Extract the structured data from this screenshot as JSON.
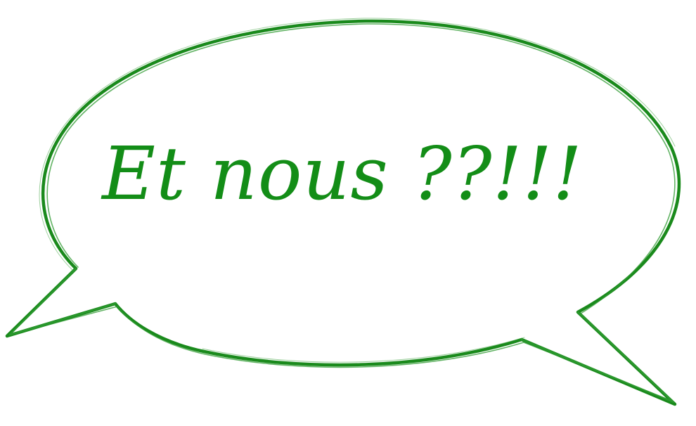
{
  "bubble": {
    "text": "Et nous ??!!!",
    "stroke_color": "#1a8a1c",
    "text_color": "#138d17",
    "background_color": "#ffffff"
  }
}
